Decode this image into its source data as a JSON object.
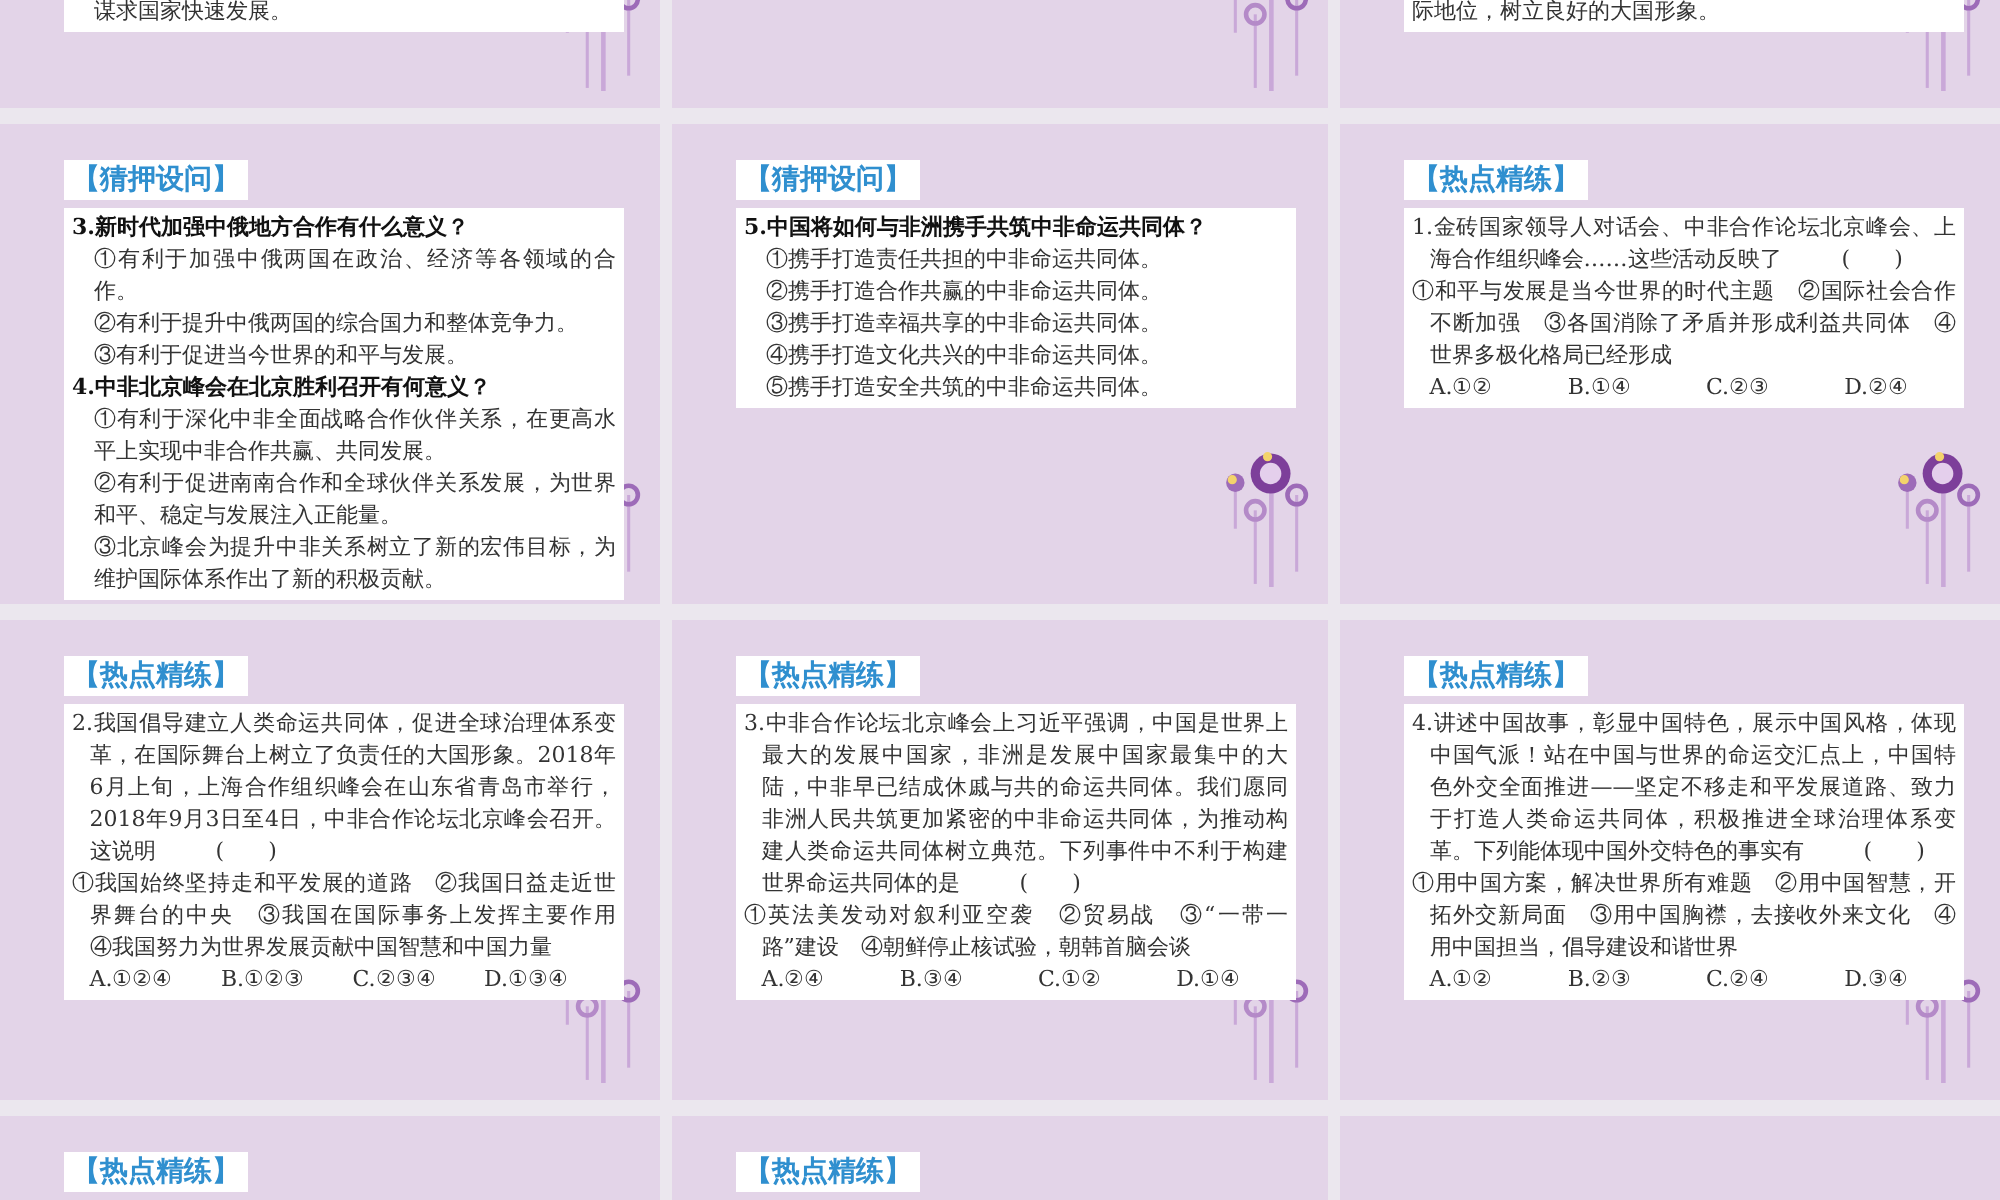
{
  "slides": [
    {
      "kind": "partial",
      "paragraphs": [
        {
          "kind": "text",
          "text": "谋求国家快速发展。"
        }
      ]
    },
    {
      "kind": "partial"
    },
    {
      "kind": "partial",
      "paragraphs": [
        {
          "kind": "plain",
          "text": "际地位，树立良好的大国形象。"
        }
      ]
    },
    {
      "kind": "full",
      "tag": "【猜押设问】",
      "paragraphs": [
        {
          "kind": "question",
          "text": "3.新时代加强中俄地方合作有什么意义？"
        },
        {
          "kind": "text",
          "text": "①有利于加强中俄两国在政治、经济等各领域的合作。"
        },
        {
          "kind": "text",
          "text": "②有利于提升中俄两国的综合国力和整体竞争力。"
        },
        {
          "kind": "text",
          "text": "③有利于促进当今世界的和平与发展。"
        },
        {
          "kind": "question",
          "text": "4.中非北京峰会在北京胜利召开有何意义？"
        },
        {
          "kind": "text",
          "text": "①有利于深化中非全面战略合作伙伴关系，在更高水平上实现中非合作共赢、共同发展。"
        },
        {
          "kind": "text",
          "text": "②有利于促进南南合作和全球伙伴关系发展，为世界和平、稳定与发展注入正能量。"
        },
        {
          "kind": "text",
          "text": "③北京峰会为提升中非关系树立了新的宏伟目标，为维护国际体系作出了新的积极贡献。"
        }
      ]
    },
    {
      "kind": "full",
      "tag": "【猜押设问】",
      "paragraphs": [
        {
          "kind": "question",
          "text": "5.中国将如何与非洲携手共筑中非命运共同体？"
        },
        {
          "kind": "text",
          "text": "①携手打造责任共担的中非命运共同体。"
        },
        {
          "kind": "text",
          "text": "②携手打造合作共赢的中非命运共同体。"
        },
        {
          "kind": "text",
          "text": "③携手打造幸福共享的中非命运共同体。"
        },
        {
          "kind": "text",
          "text": "④携手打造文化共兴的中非命运共同体。"
        },
        {
          "kind": "text",
          "text": "⑤携手打造安全共筑的中非命运共同体。"
        }
      ]
    },
    {
      "kind": "full",
      "tag": "【热点精练】",
      "paragraphs": [
        {
          "kind": "stem",
          "text": "1.金砖国家领导人对话会、中非合作论坛北京峰会、上海合作组织峰会……这些活动反映了",
          "blank": "(　　)"
        },
        {
          "kind": "hang",
          "text": "①和平与发展是当今世界的时代主题　②国际社会合作不断加强　③各国消除了矛盾并形成利益共同体　④世界多极化格局已经形成"
        },
        {
          "kind": "options",
          "items": [
            "A.①②",
            "B.①④",
            "C.②③",
            "D.②④"
          ]
        }
      ]
    },
    {
      "kind": "full",
      "tag": "【热点精练】",
      "paragraphs": [
        {
          "kind": "stem",
          "text": "2.我国倡导建立人类命运共同体，促进全球治理体系变革，在国际舞台上树立了负责任的大国形象。2018年6月上旬，上海合作组织峰会在山东省青岛市举行，2018年9月3日至4日，中非合作论坛北京峰会召开。这说明",
          "blank": "(　　)"
        },
        {
          "kind": "hang",
          "text": "①我国始终坚持走和平发展的道路　②我国日益走近世界舞台的中央　③我国在国际事务上发挥主要作用　④我国努力为世界发展贡献中国智慧和中国力量"
        },
        {
          "kind": "options",
          "items": [
            "A.①②④",
            "B.①②③",
            "C.②③④",
            "D.①③④"
          ]
        }
      ]
    },
    {
      "kind": "full",
      "tag": "【热点精练】",
      "paragraphs": [
        {
          "kind": "stem",
          "text": "3.中非合作论坛北京峰会上习近平强调，中国是世界上最大的发展中国家，非洲是发展中国家最集中的大陆，中非早已结成休戚与共的命运共同体。我们愿同非洲人民共筑更加紧密的中非命运共同体，为推动构建人类命运共同体树立典范。下列事件中不利于构建世界命运共同体的是",
          "blank": "(　　)"
        },
        {
          "kind": "hang",
          "text": "①英法美发动对叙利亚空袭　②贸易战　③“一带一路”建设　④朝鲜停止核试验，朝韩首脑会谈"
        },
        {
          "kind": "options",
          "items": [
            "A.②④",
            "B.③④",
            "C.①②",
            "D.①④"
          ]
        }
      ]
    },
    {
      "kind": "full",
      "tag": "【热点精练】",
      "paragraphs": [
        {
          "kind": "stem",
          "text": "4.讲述中国故事，彰显中国特色，展示中国风格，体现中国气派！站在中国与世界的命运交汇点上，中国特色外交全面推进——坚定不移走和平发展道路、致力于打造人类命运共同体，积极推进全球治理体系变革。下列能体现中国外交特色的事实有",
          "blank": "(　　)"
        },
        {
          "kind": "hang",
          "text": "①用中国方案，解决世界所有难题　②用中国智慧，开拓外交新局面　③用中国胸襟，去接收外来文化　④用中国担当，倡导建设和谐世界"
        },
        {
          "kind": "options",
          "items": [
            "A.①②",
            "B.②③",
            "C.②④",
            "D.③④"
          ]
        }
      ]
    },
    {
      "kind": "full",
      "tag": "【热点精练】"
    },
    {
      "kind": "full",
      "tag": "【热点精练】"
    },
    {
      "kind": "full"
    }
  ]
}
